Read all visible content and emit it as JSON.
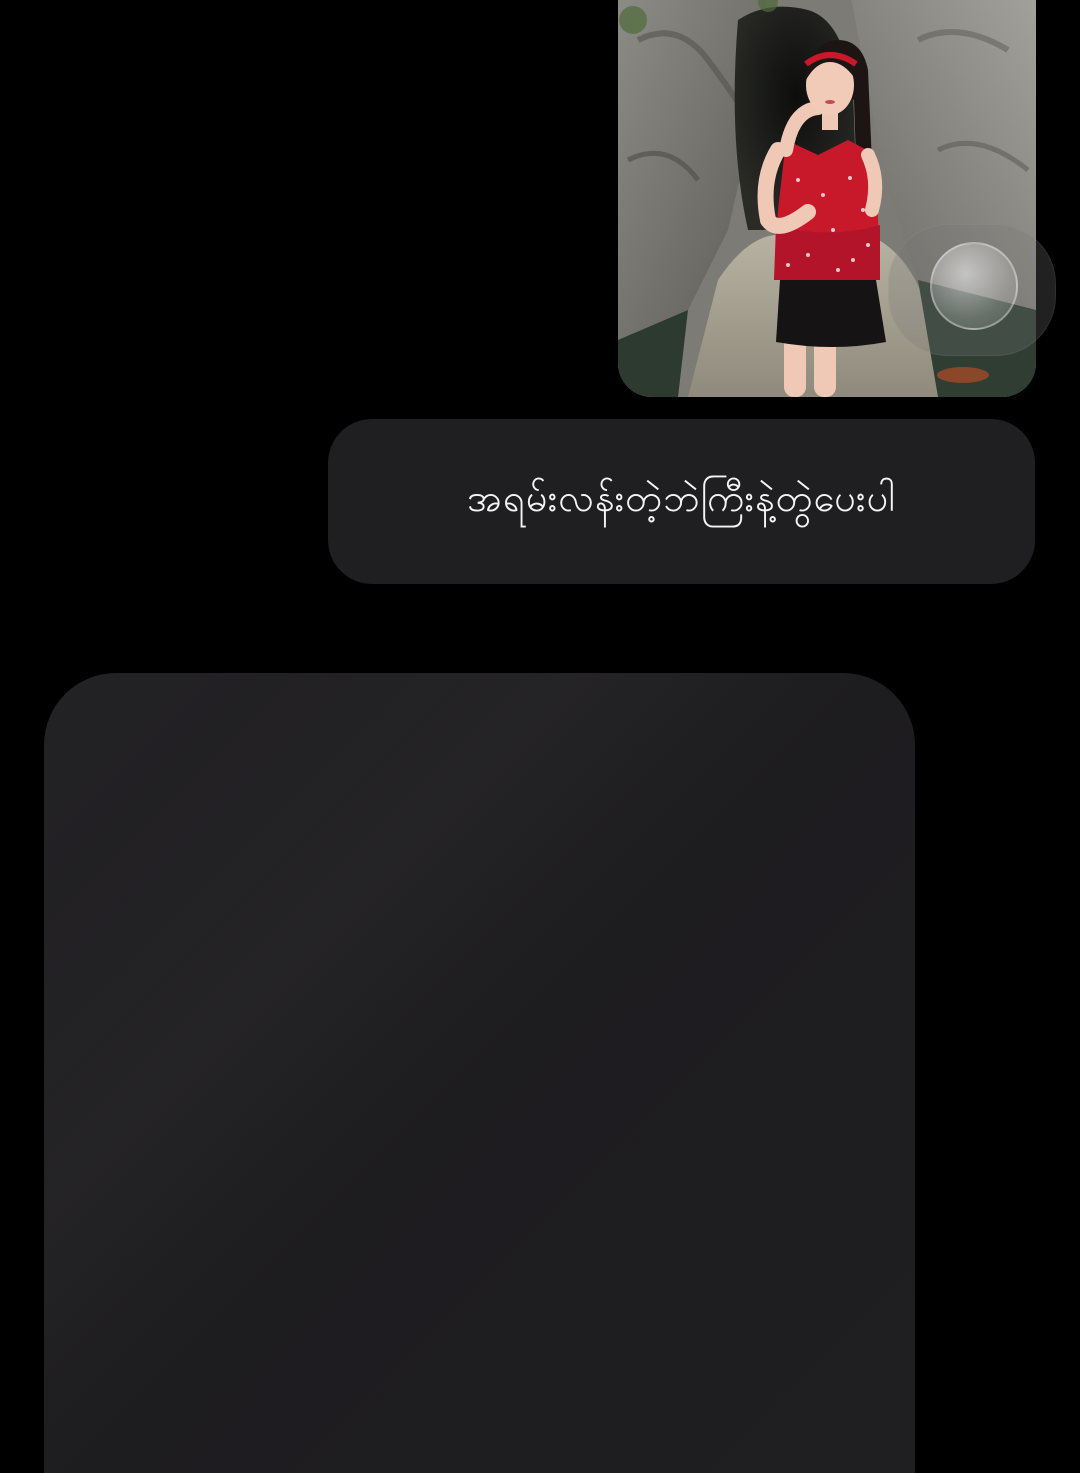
{
  "conversation": {
    "sent_photo": {
      "icon": "photo-image-icon",
      "has_floating_button": true
    },
    "sent_message": {
      "text": "အရမ်းလန်းတဲ့ဘဲကြီးနဲ့တွဲပေးပါ"
    },
    "reply": {
      "state": "loading"
    }
  },
  "colors": {
    "background": "#000000",
    "bubble": "#1f1e21",
    "text": "#f4f4f4",
    "dress": "#c8192b"
  }
}
